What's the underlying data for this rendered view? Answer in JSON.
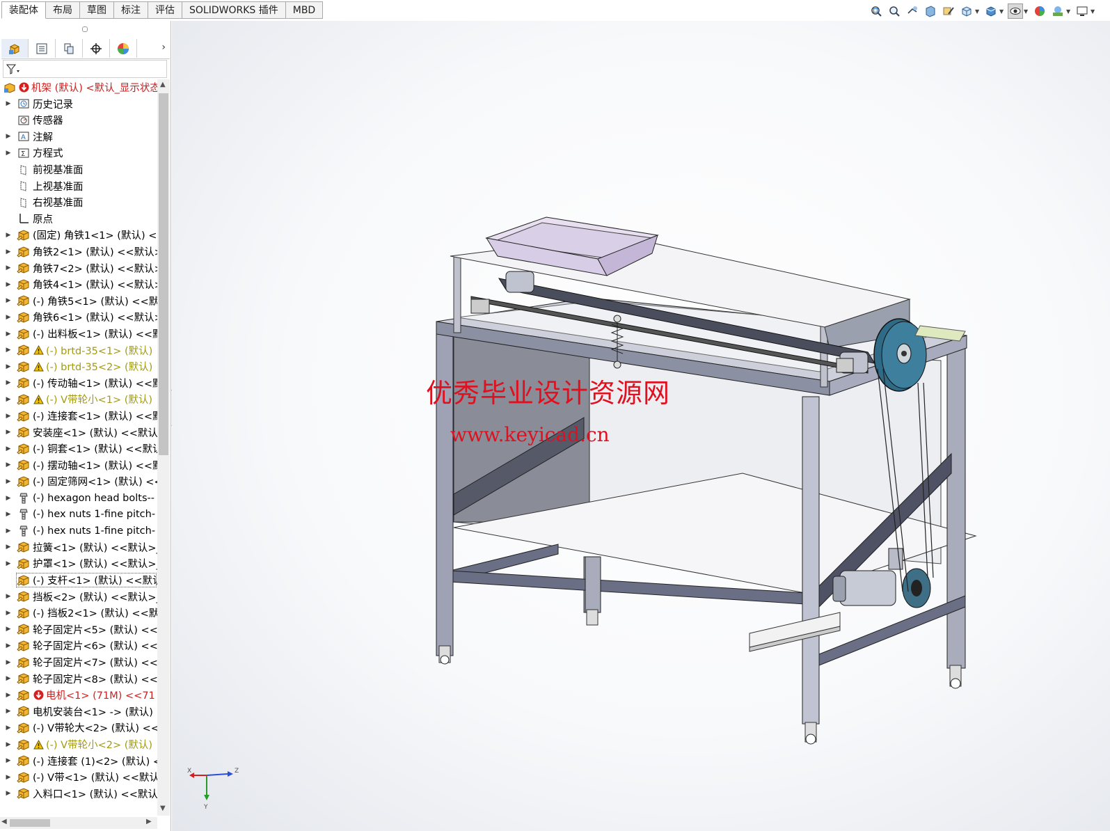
{
  "command_tabs": [
    "装配体",
    "布局",
    "草图",
    "标注",
    "评估",
    "SOLIDWORKS 插件",
    "MBD"
  ],
  "view_toolbar_icons": [
    "zoom-to-fit-icon",
    "zoom-to-area-icon",
    "previous-view-icon",
    "section-view-icon",
    "dynamic-annotation-icon",
    "view-orientation-icon",
    "display-style-icon",
    "hide-show-items-icon",
    "edit-appearance-icon",
    "apply-scene-icon",
    "view-settings-icon"
  ],
  "manager_tabs": [
    "featuremanager-icon",
    "propertymanager-icon",
    "configurationmanager-icon",
    "dimxpertmanager-icon",
    "displaymanager-icon"
  ],
  "tree": {
    "root": "机架 (默认) <默认_显示状态",
    "items": [
      {
        "label": "历史记录",
        "icon": "history-icon",
        "expand": true,
        "state": "normal"
      },
      {
        "label": "传感器",
        "icon": "sensor-icon",
        "expand": false,
        "state": "normal"
      },
      {
        "label": "注解",
        "icon": "annotation-icon",
        "expand": true,
        "state": "normal"
      },
      {
        "label": "方程式",
        "icon": "equation-icon",
        "expand": true,
        "state": "normal"
      },
      {
        "label": "前视基准面",
        "icon": "plane-icon",
        "expand": false,
        "state": "normal"
      },
      {
        "label": "上视基准面",
        "icon": "plane-icon",
        "expand": false,
        "state": "normal"
      },
      {
        "label": "右视基准面",
        "icon": "plane-icon",
        "expand": false,
        "state": "normal"
      },
      {
        "label": "原点",
        "icon": "origin-icon",
        "expand": false,
        "state": "normal"
      },
      {
        "label": "(固定) 角铁1<1> (默认) <<",
        "icon": "part-icon",
        "expand": true,
        "state": "normal"
      },
      {
        "label": "角铁2<1> (默认) <<默认>",
        "icon": "part-icon",
        "expand": true,
        "state": "normal"
      },
      {
        "label": "角铁7<2> (默认) <<默认>",
        "icon": "part-icon",
        "expand": true,
        "state": "normal"
      },
      {
        "label": "角铁4<1> (默认) <<默认>",
        "icon": "part-icon",
        "expand": true,
        "state": "normal"
      },
      {
        "label": "(-) 角铁5<1> (默认) <<默",
        "icon": "part-icon",
        "expand": true,
        "state": "normal"
      },
      {
        "label": "角铁6<1> (默认) <<默认>",
        "icon": "part-icon",
        "expand": true,
        "state": "normal"
      },
      {
        "label": "(-) 出料板<1> (默认) <<默",
        "icon": "part-icon",
        "expand": true,
        "state": "normal"
      },
      {
        "label": "(-) brtd-35<1> (默认)",
        "icon": "part-icon",
        "expand": true,
        "state": "warning"
      },
      {
        "label": "(-) brtd-35<2> (默认)",
        "icon": "part-icon",
        "expand": true,
        "state": "warning"
      },
      {
        "label": "(-) 传动轴<1> (默认) <<默",
        "icon": "part-icon",
        "expand": true,
        "state": "normal"
      },
      {
        "label": "(-) V带轮小<1> (默认)",
        "icon": "part-icon",
        "expand": true,
        "state": "warning"
      },
      {
        "label": "(-) 连接套<1> (默认) <<默",
        "icon": "part-icon",
        "expand": true,
        "state": "normal"
      },
      {
        "label": "安装座<1> (默认) <<默认",
        "icon": "part-icon",
        "expand": true,
        "state": "normal"
      },
      {
        "label": "(-) 铜套<1> (默认) <<默认",
        "icon": "part-icon",
        "expand": true,
        "state": "normal"
      },
      {
        "label": "(-) 摆动轴<1> (默认) <<默",
        "icon": "part-icon",
        "expand": true,
        "state": "normal"
      },
      {
        "label": "(-) 固定筛网<1> (默认) <<",
        "icon": "part-icon",
        "expand": true,
        "state": "normal"
      },
      {
        "label": "(-) hexagon head bolts--",
        "icon": "bolt-icon",
        "expand": true,
        "state": "normal"
      },
      {
        "label": "(-) hex nuts 1-fine pitch-",
        "icon": "bolt-icon",
        "expand": true,
        "state": "normal"
      },
      {
        "label": "(-) hex nuts 1-fine pitch-",
        "icon": "bolt-icon",
        "expand": true,
        "state": "normal"
      },
      {
        "label": "拉簧<1> (默认) <<默认>_",
        "icon": "part-icon",
        "expand": true,
        "state": "normal"
      },
      {
        "label": "护罩<1> (默认) <<默认>_",
        "icon": "part-icon",
        "expand": true,
        "state": "normal"
      },
      {
        "label": "(-) 支杆<1> (默认) <<默认",
        "icon": "part-icon",
        "expand": true,
        "state": "selected"
      },
      {
        "label": "挡板<2> (默认) <<默认>_",
        "icon": "part-icon",
        "expand": true,
        "state": "normal"
      },
      {
        "label": "(-) 挡板2<1> (默认) <<默",
        "icon": "part-icon",
        "expand": true,
        "state": "normal"
      },
      {
        "label": "轮子固定片<5> (默认) <<",
        "icon": "part-icon",
        "expand": true,
        "state": "normal"
      },
      {
        "label": "轮子固定片<6> (默认) <<",
        "icon": "part-icon",
        "expand": true,
        "state": "normal"
      },
      {
        "label": "轮子固定片<7> (默认) <<",
        "icon": "part-icon",
        "expand": true,
        "state": "normal"
      },
      {
        "label": "轮子固定片<8> (默认) <<",
        "icon": "part-icon",
        "expand": true,
        "state": "normal"
      },
      {
        "label": "电机<1> (71M) <<71",
        "icon": "part-icon",
        "expand": true,
        "state": "error"
      },
      {
        "label": "电机安装台<1> -> (默认)",
        "icon": "part-icon",
        "expand": true,
        "state": "normal"
      },
      {
        "label": "(-) V带轮大<2> (默认) <<",
        "icon": "part-icon",
        "expand": true,
        "state": "normal"
      },
      {
        "label": "(-) V带轮小<2> (默认)",
        "icon": "part-icon",
        "expand": true,
        "state": "warning"
      },
      {
        "label": "(-) 连接套 (1)<2> (默认) <",
        "icon": "part-icon",
        "expand": true,
        "state": "normal"
      },
      {
        "label": "(-) V带<1> (默认) <<默认",
        "icon": "part-icon",
        "expand": true,
        "state": "normal"
      },
      {
        "label": "入料口<1> (默认) <<默认",
        "icon": "part-icon",
        "expand": true,
        "state": "normal"
      }
    ]
  },
  "watermark": {
    "line1": "优秀毕业设计资源网",
    "line2": "www.keyicad.cn"
  },
  "triad": {
    "x": "X",
    "y": "Y",
    "z": "Z"
  },
  "colors": {
    "error": "#cc1f1f",
    "warning": "#a29a12",
    "watermark": "#e0101f",
    "part": "#f2b632"
  }
}
